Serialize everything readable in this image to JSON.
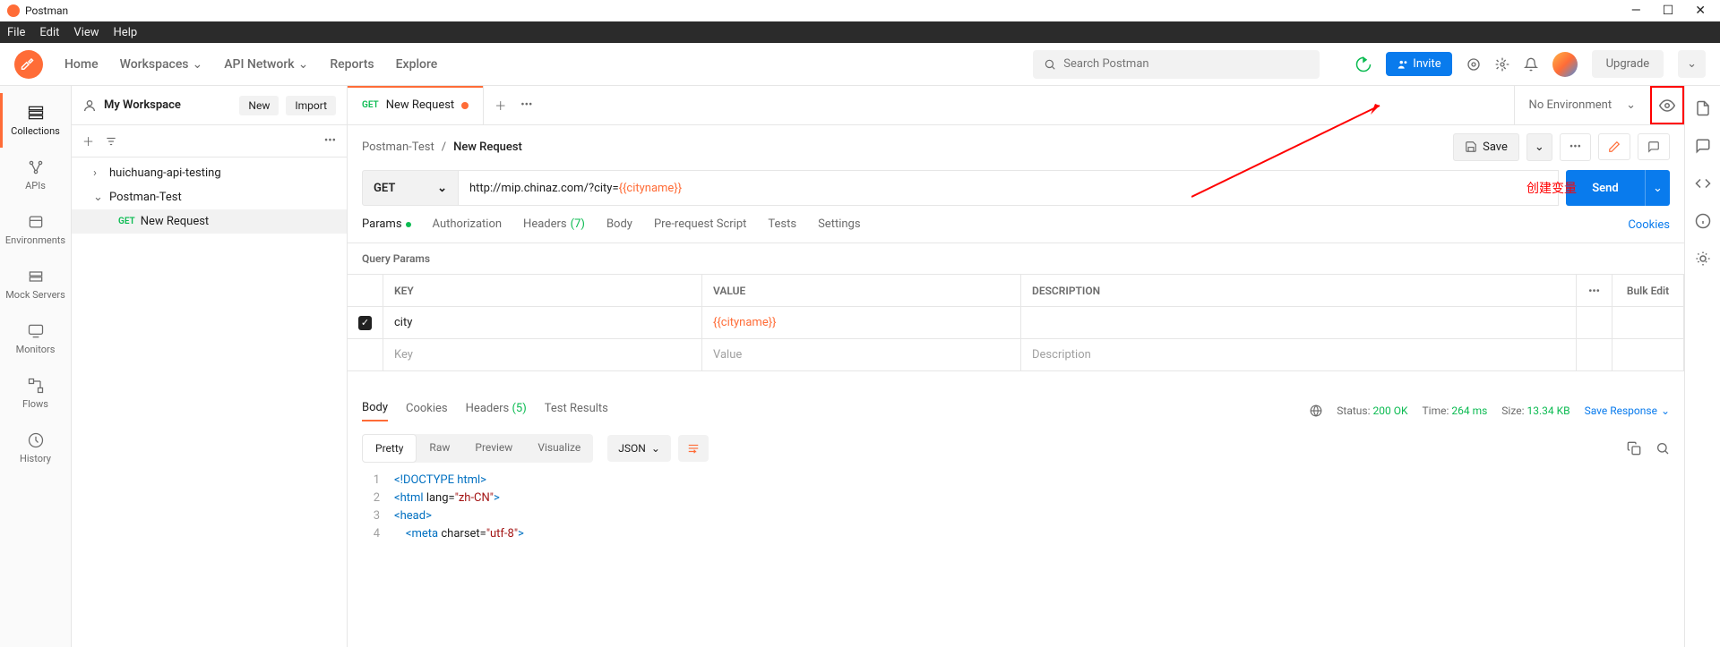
{
  "app": {
    "title": "Postman"
  },
  "menubar": [
    "File",
    "Edit",
    "View",
    "Help"
  ],
  "topnav": {
    "items": [
      "Home",
      "Workspaces",
      "API Network",
      "Reports",
      "Explore"
    ],
    "search_placeholder": "Search Postman",
    "invite": "Invite",
    "upgrade": "Upgrade"
  },
  "workspace": {
    "name": "My Workspace",
    "new_btn": "New",
    "import_btn": "Import"
  },
  "sidebar": {
    "items": [
      {
        "label": "Collections"
      },
      {
        "label": "APIs"
      },
      {
        "label": "Environments"
      },
      {
        "label": "Mock Servers"
      },
      {
        "label": "Monitors"
      },
      {
        "label": "Flows"
      },
      {
        "label": "History"
      }
    ]
  },
  "collections": {
    "item1": "huichuang-api-testing",
    "item2": "Postman-Test",
    "item3_method": "GET",
    "item3": "New Request"
  },
  "tabs": {
    "tab1_method": "GET",
    "tab1_label": "New Request"
  },
  "environment": {
    "label": "No Environment"
  },
  "breadcrumb": {
    "parent": "Postman-Test",
    "current": "New Request",
    "save": "Save"
  },
  "request": {
    "method": "GET",
    "url_prefix": "http://mip.chinaz.com/?city=",
    "url_var": "{{cityname}}",
    "send": "Send",
    "annotation": "创建变量"
  },
  "reqtabs": {
    "params": "Params",
    "auth": "Authorization",
    "headers": "Headers",
    "headers_count": "(7)",
    "body": "Body",
    "prerequest": "Pre-request Script",
    "tests": "Tests",
    "settings": "Settings",
    "cookies": "Cookies"
  },
  "params": {
    "section": "Query Params",
    "col_key": "KEY",
    "col_value": "VALUE",
    "col_desc": "DESCRIPTION",
    "bulk": "Bulk Edit",
    "rows": [
      {
        "key": "city",
        "value": "{{cityname}}",
        "desc": ""
      }
    ],
    "placeholder_key": "Key",
    "placeholder_value": "Value",
    "placeholder_desc": "Description"
  },
  "response": {
    "tabs": {
      "body": "Body",
      "cookies": "Cookies",
      "headers": "Headers",
      "headers_count": "(5)",
      "tests": "Test Results"
    },
    "status_label": "Status:",
    "status_value": "200 OK",
    "time_label": "Time:",
    "time_value": "264 ms",
    "size_label": "Size:",
    "size_value": "13.34 KB",
    "save_response": "Save Response",
    "views": {
      "pretty": "Pretty",
      "raw": "Raw",
      "preview": "Preview",
      "visualize": "Visualize"
    },
    "format": "JSON",
    "code": [
      "<!DOCTYPE html>",
      "<html lang=\"zh-CN\">",
      "<head>",
      "    <meta charset=\"utf-8\">"
    ]
  }
}
